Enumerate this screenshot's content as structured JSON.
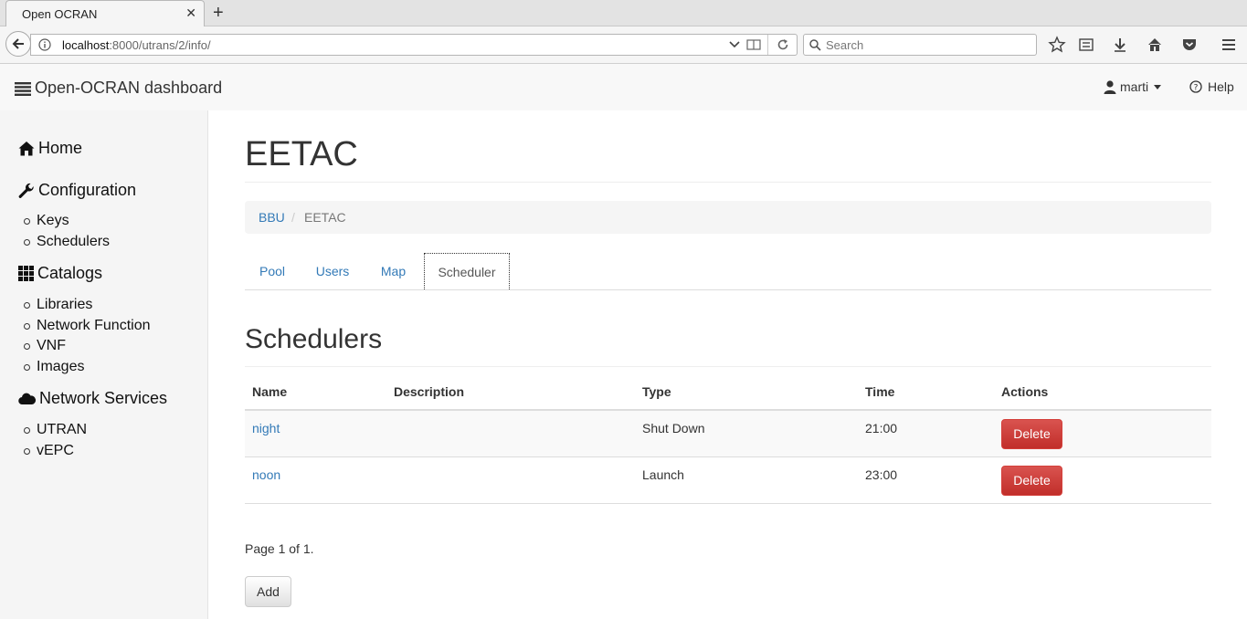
{
  "browser": {
    "tab_title": "Open OCRAN",
    "url_host": "localhost",
    "url_rest": ":8000/utrans/2/info/",
    "search_placeholder": "Search"
  },
  "header": {
    "brand": "Open-OCRAN dashboard",
    "user": "marti",
    "help": "Help"
  },
  "sidebar": {
    "home": "Home",
    "configuration": "Configuration",
    "config_items": [
      "Keys",
      "Schedulers"
    ],
    "catalogs": "Catalogs",
    "catalog_items": [
      "Libraries",
      "Network Function",
      "VNF",
      "Images"
    ],
    "network_services": "Network Services",
    "ns_items": [
      "UTRAN",
      "vEPC"
    ]
  },
  "main": {
    "title": "EETAC",
    "breadcrumb": {
      "parent": "BBU",
      "current": "EETAC"
    },
    "tabs": [
      "Pool",
      "Users",
      "Map",
      "Scheduler"
    ],
    "active_tab": "Scheduler",
    "section_title": "Schedulers",
    "table": {
      "headers": [
        "Name",
        "Description",
        "Type",
        "Time",
        "Actions"
      ],
      "rows": [
        {
          "name": "night",
          "description": "",
          "type": "Shut Down",
          "time": "21:00",
          "action": "Delete"
        },
        {
          "name": "noon",
          "description": "",
          "type": "Launch",
          "time": "23:00",
          "action": "Delete"
        }
      ]
    },
    "pager": "Page 1 of 1.",
    "add_label": "Add"
  },
  "colors": {
    "link": "#337ab7",
    "danger": "#d9534f",
    "sidebar_bg": "#f5f5f5"
  }
}
